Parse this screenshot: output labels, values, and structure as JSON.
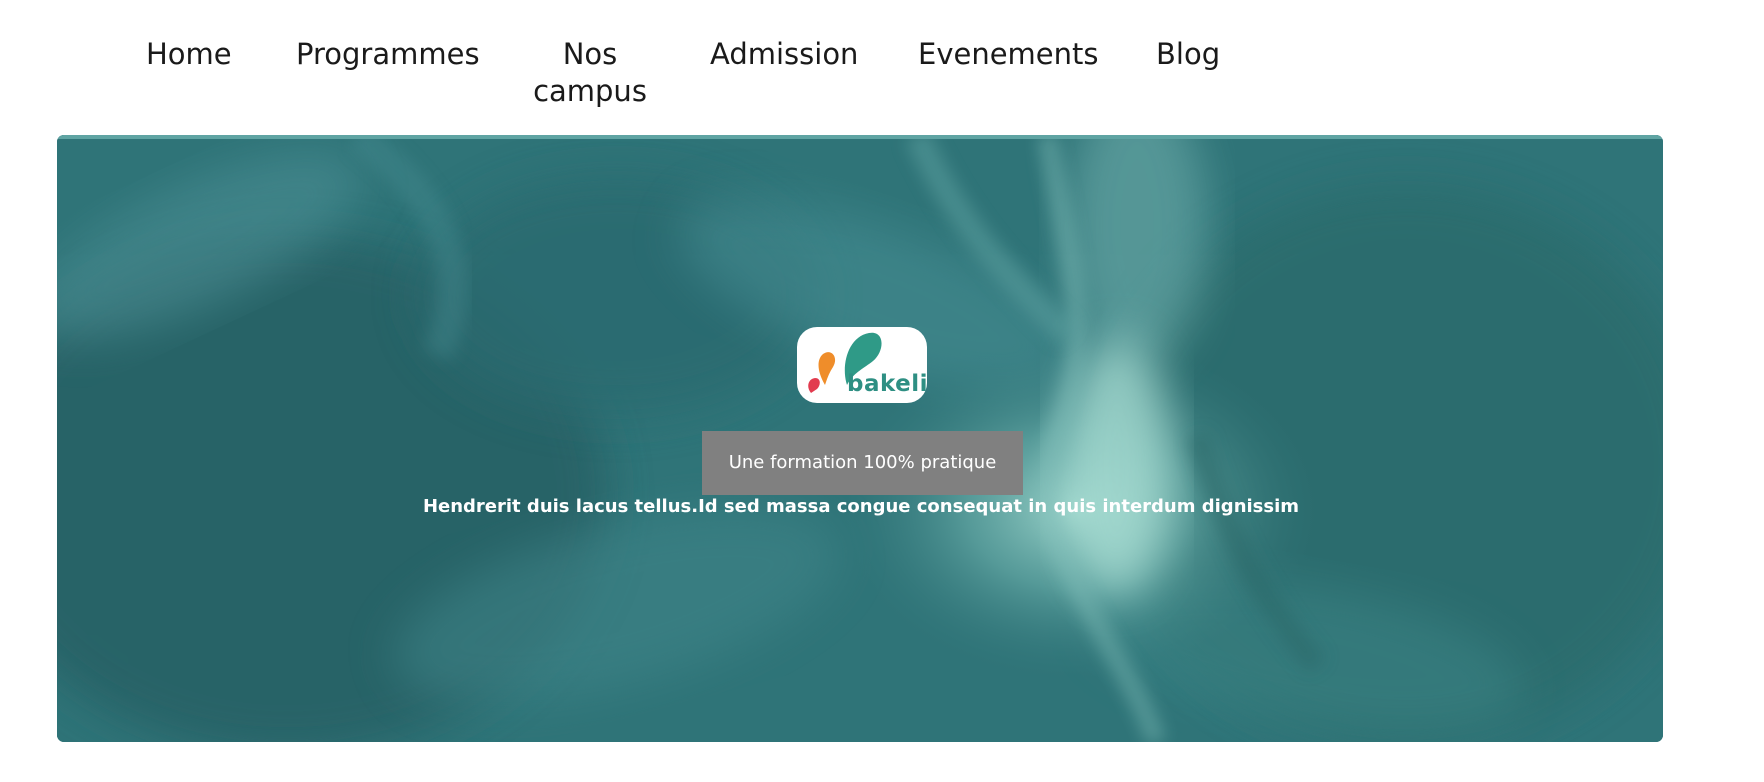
{
  "nav": {
    "items": [
      {
        "label": "Home"
      },
      {
        "label": "Programmes"
      },
      {
        "label": "Nos campus"
      },
      {
        "label": "Admission"
      },
      {
        "label": "Evenements"
      },
      {
        "label": "Blog"
      }
    ]
  },
  "hero": {
    "logo_text": "bakeli",
    "cta_label": "Une formation 100% pratique",
    "subtitle": "Hendrerit duis lacus tellus.Id sed massa congue consequat in quis interdum dignissim"
  },
  "colors": {
    "hero_base": "#2f7478",
    "cta_bg": "#808080",
    "logo_text": "#2e8f83",
    "logo_orange": "#ef8d2a",
    "logo_red": "#e23b4f",
    "logo_teal": "#2f9a87"
  },
  "icons": {
    "logo_mark": "bakeli-drops-logo"
  }
}
